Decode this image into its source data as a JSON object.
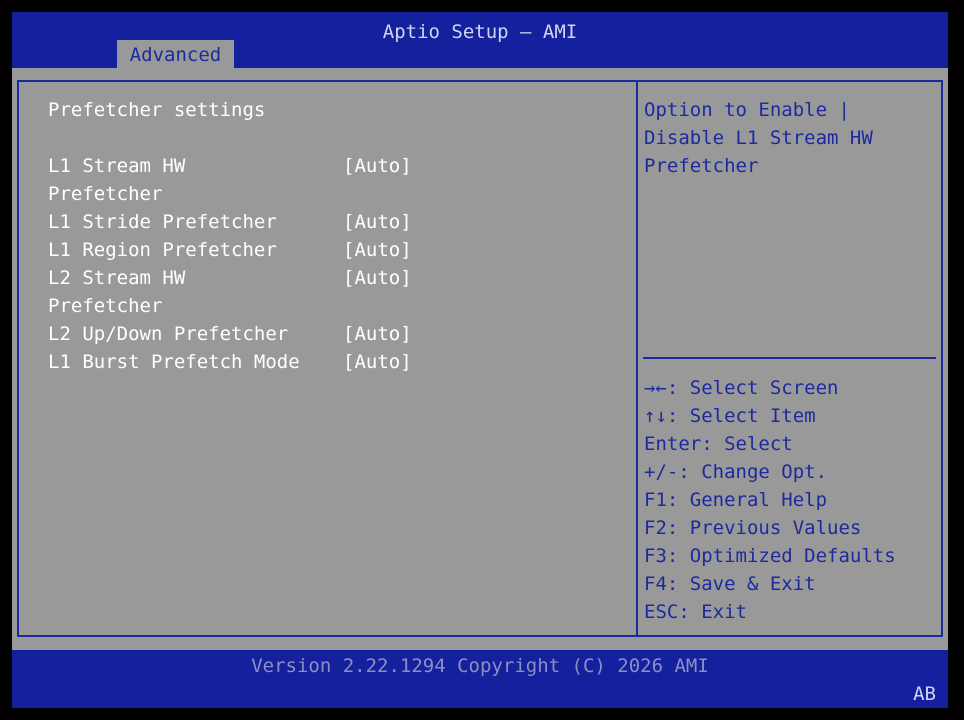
{
  "header": {
    "title": "Aptio Setup – AMI",
    "tabs": [
      {
        "label": "Advanced"
      }
    ]
  },
  "main": {
    "section_title": "Prefetcher settings",
    "settings": [
      {
        "label_lines": [
          "L1 Stream HW",
          "Prefetcher"
        ],
        "value": "[Auto]"
      },
      {
        "label_lines": [
          "L1 Stride Prefetcher"
        ],
        "value": "[Auto]"
      },
      {
        "label_lines": [
          "L1 Region Prefetcher"
        ],
        "value": "[Auto]"
      },
      {
        "label_lines": [
          "L2 Stream HW",
          "Prefetcher"
        ],
        "value": "[Auto]"
      },
      {
        "label_lines": [
          "L2 Up/Down Prefetcher"
        ],
        "value": "[Auto]"
      },
      {
        "label_lines": [
          "L1 Burst Prefetch Mode"
        ],
        "value": "[Auto]"
      }
    ]
  },
  "help": {
    "lines": [
      "Option to Enable |",
      "Disable L1 Stream HW",
      "Prefetcher"
    ]
  },
  "keys": [
    "→←: Select Screen",
    "↑↓: Select Item",
    "Enter: Select",
    "+/-: Change Opt.",
    "F1: General Help",
    "F2: Previous Values",
    "F3: Optimized Defaults",
    "F4: Save & Exit",
    "ESC: Exit"
  ],
  "footer": {
    "version": "Version 2.22.1294 Copyright (C) 2026 AMI",
    "badge": "AB"
  },
  "colors": {
    "bar_blue": "#14209e",
    "text_blue": "#1c2a9e",
    "panel_gray": "#999999",
    "text_white": "#ffffff"
  }
}
